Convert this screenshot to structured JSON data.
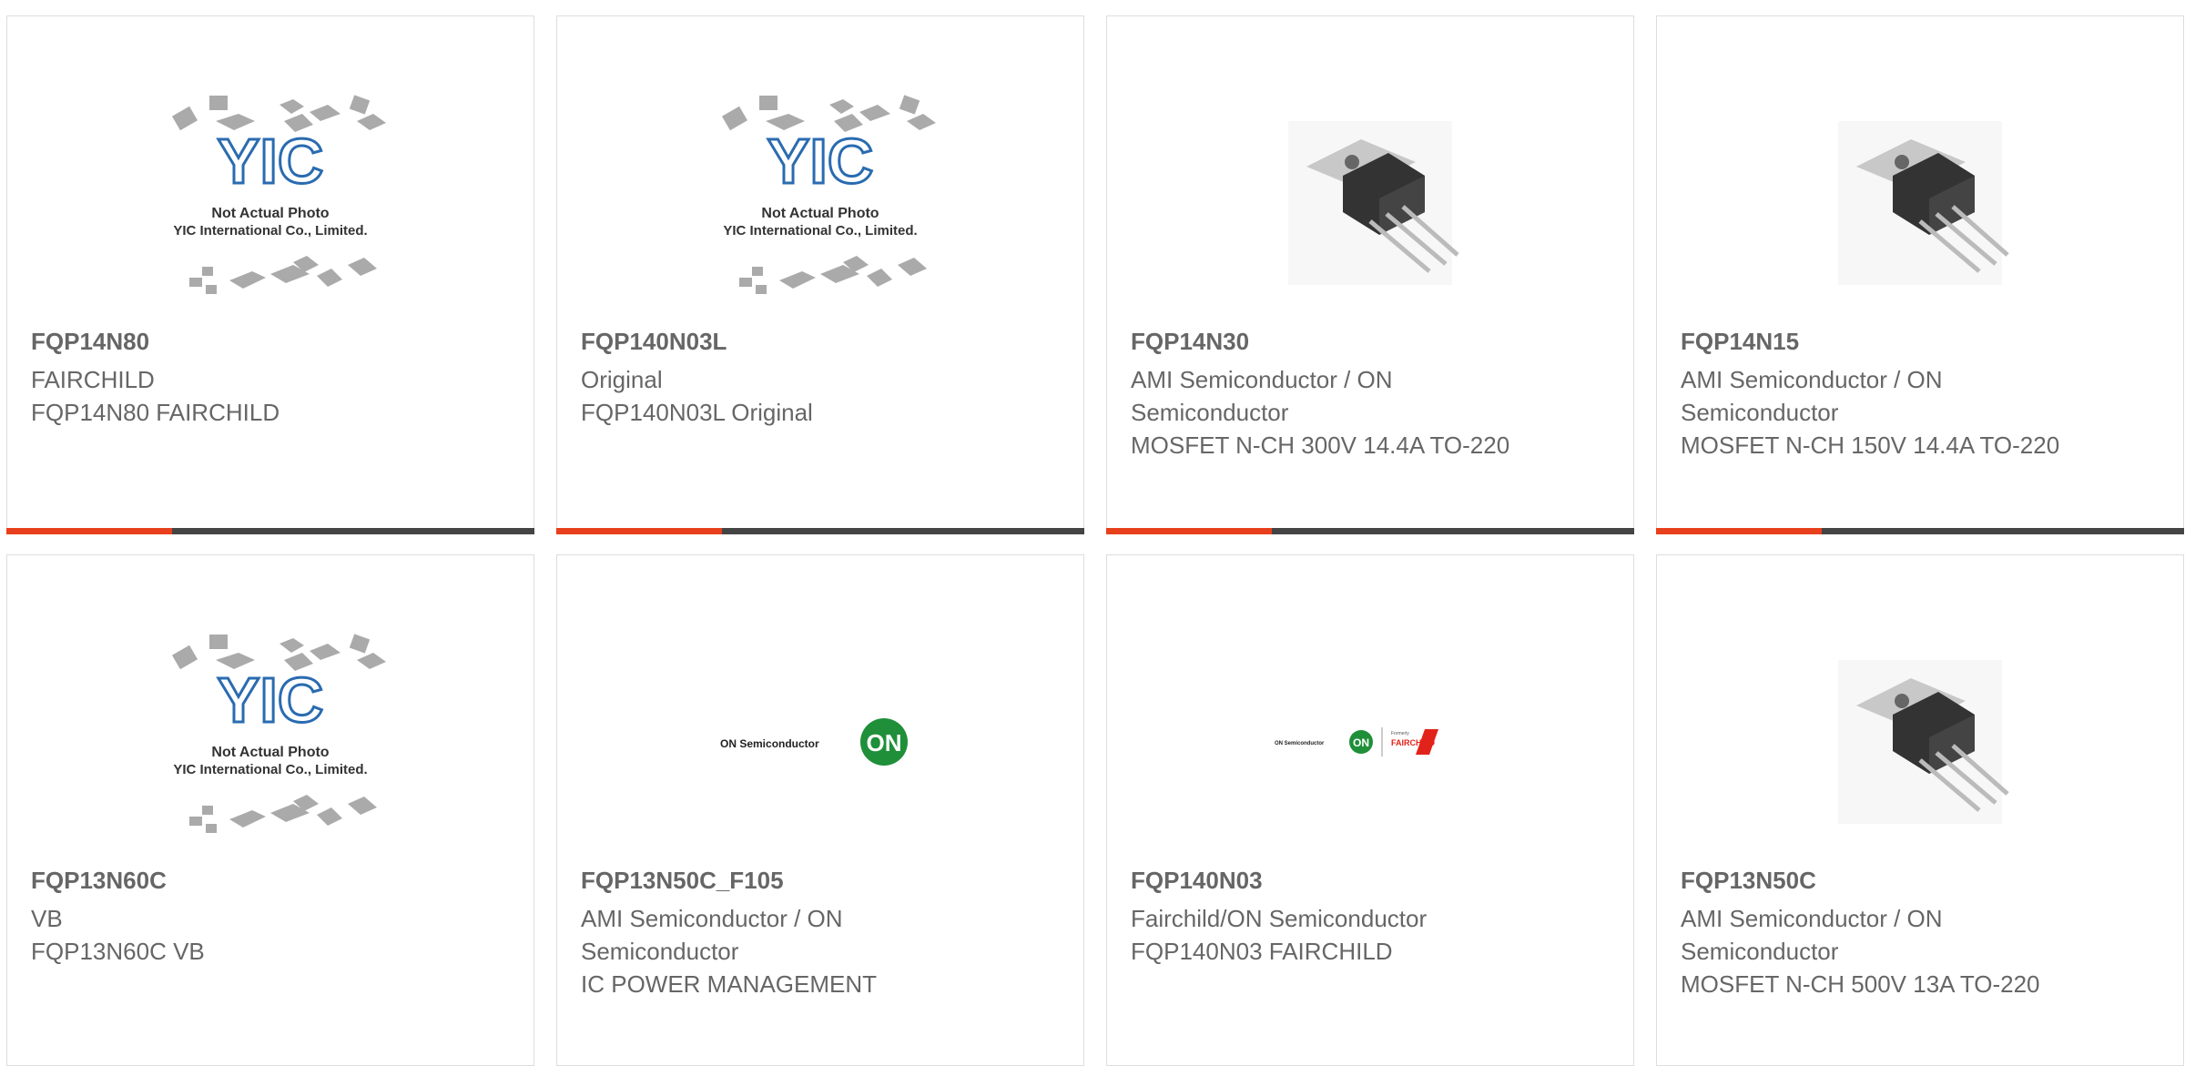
{
  "products": [
    {
      "name": "FQP14N80",
      "brand": "FAIRCHILD",
      "desc": "FQP14N80 FAIRCHILD",
      "image": "yic-placeholder",
      "placeholder_lines": [
        "Not Actual Photo",
        "YIC International Co., Limited."
      ]
    },
    {
      "name": "FQP140N03L",
      "brand": "Original",
      "desc": "FQP140N03L Original",
      "image": "yic-placeholder",
      "placeholder_lines": [
        "Not Actual Photo",
        "YIC International Co., Limited."
      ]
    },
    {
      "name": "FQP14N30",
      "brand": "AMI Semiconductor / ON Semiconductor",
      "desc": "MOSFET N-CH 300V 14.4A TO-220",
      "image": "to220-transistor"
    },
    {
      "name": "FQP14N15",
      "brand": "AMI Semiconductor / ON Semiconductor",
      "desc": "MOSFET N-CH 150V 14.4A TO-220",
      "image": "to220-transistor"
    },
    {
      "name": "FQP13N60C",
      "brand": "VB",
      "desc": "FQP13N60C VB",
      "image": "yic-placeholder",
      "placeholder_lines": [
        "Not Actual Photo",
        "YIC International Co., Limited."
      ]
    },
    {
      "name": "FQP13N50C_F105",
      "brand": "AMI Semiconductor / ON Semiconductor",
      "desc": "IC POWER MANAGEMENT",
      "image": "on-semiconductor-logo",
      "logo_text": "ON Semiconductor",
      "logo_mark": "ON"
    },
    {
      "name": "FQP140N03",
      "brand": "Fairchild/ON Semiconductor",
      "desc": "FQP140N03 FAIRCHILD",
      "image": "on-fairchild-logo",
      "logo_text": "ON Semiconductor",
      "logo_mark": "ON",
      "logo_small": "Formerly",
      "logo_brand": "FAIRCHILD"
    },
    {
      "name": "FQP13N50C",
      "brand": "AMI Semiconductor / ON Semiconductor",
      "desc": "MOSFET N-CH 500V 13A TO-220",
      "image": "to220-transistor"
    }
  ],
  "colors": {
    "accent": "#e8401c",
    "bar": "#444444",
    "text": "#666666",
    "yic_blue": "#2a6bb0",
    "on_green": "#1f8f3a",
    "fairchild_red": "#e2231a"
  }
}
